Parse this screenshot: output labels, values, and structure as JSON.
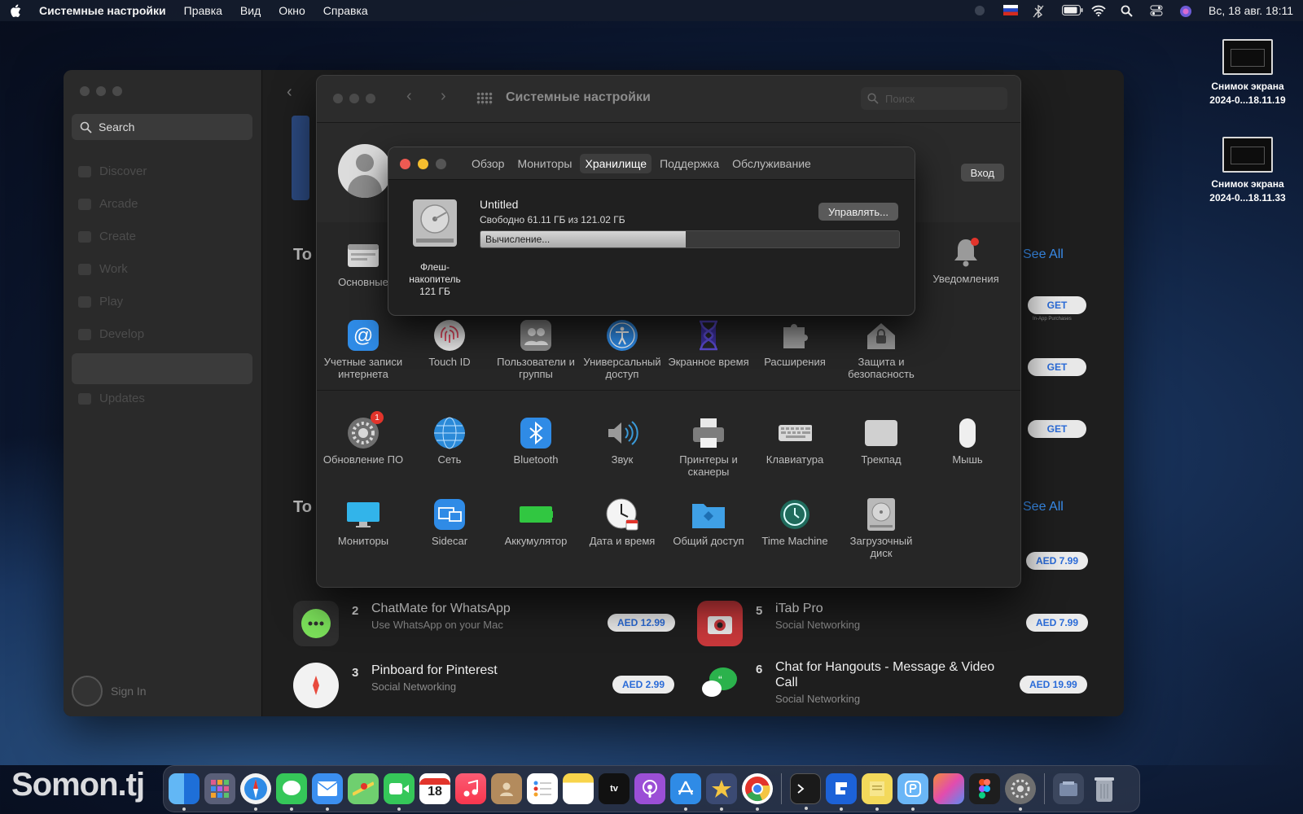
{
  "menubar": {
    "app_name": "Системные настройки",
    "items": [
      "Правка",
      "Вид",
      "Окно",
      "Справка"
    ],
    "datetime": "Вс, 18 авг.  18:11"
  },
  "desktop": {
    "files": [
      {
        "title": "Снимок экрана",
        "subtitle": "2024-0...18.11.19"
      },
      {
        "title": "Снимок экрана",
        "subtitle": "2024-0...18.11.33"
      }
    ]
  },
  "appstore": {
    "search_label": "Search",
    "nav": [
      "Discover",
      "Arcade",
      "Create",
      "Work",
      "Play",
      "Develop",
      "",
      "Updates"
    ],
    "sign_in": "Sign In",
    "section_head_1": "To",
    "section_head_2": "To",
    "see_all": "See All",
    "get_label": "GET",
    "iap_note": "In-App Purchases",
    "prices_top": [
      "AED 7.99"
    ],
    "apps": [
      {
        "rank": "2",
        "name": "ChatMate for WhatsApp",
        "sub": "Use WhatsApp on your Mac",
        "price": "AED 12.99"
      },
      {
        "rank": "3",
        "name": "Pinboard for Pinterest",
        "sub": "Social Networking",
        "price": "AED 2.99"
      },
      {
        "rank": "5",
        "name": "iTab Pro",
        "sub": "Social Networking",
        "price": "AED 7.99"
      },
      {
        "rank": "6",
        "name": "Chat for Hangouts - Message & Video Call",
        "sub": "Social Networking",
        "price": "AED 19.99"
      }
    ]
  },
  "syspref": {
    "title": "Системные настройки",
    "search_placeholder": "Поиск",
    "login_button": "Вход",
    "row0": [
      {
        "label": "Основные",
        "icon": "general-icon"
      },
      {
        "label": "Уведомления",
        "icon": "bell-icon"
      }
    ],
    "row1": [
      {
        "label": "Учетные записи интернета",
        "icon": "at-icon"
      },
      {
        "label": "Touch ID",
        "icon": "fingerprint-icon"
      },
      {
        "label": "Пользователи и группы",
        "icon": "users-icon"
      },
      {
        "label": "Универсальный доступ",
        "icon": "accessibility-icon"
      },
      {
        "label": "Экранное время",
        "icon": "hourglass-icon"
      },
      {
        "label": "Расширения",
        "icon": "puzzle-icon"
      },
      {
        "label": "Защита и безопасность",
        "icon": "house-lock-icon"
      }
    ],
    "row2": [
      {
        "label": "Обновление ПО",
        "icon": "gear-icon",
        "badge": "1"
      },
      {
        "label": "Сеть",
        "icon": "globe-icon"
      },
      {
        "label": "Bluetooth",
        "icon": "bluetooth-icon"
      },
      {
        "label": "Звук",
        "icon": "speaker-icon"
      },
      {
        "label": "Принтеры и сканеры",
        "icon": "printer-icon"
      },
      {
        "label": "Клавиатура",
        "icon": "keyboard-icon"
      },
      {
        "label": "Трекпад",
        "icon": "trackpad-icon"
      },
      {
        "label": "Мышь",
        "icon": "mouse-icon"
      }
    ],
    "row3": [
      {
        "label": "Мониторы",
        "icon": "monitor-icon"
      },
      {
        "label": "Sidecar",
        "icon": "sidecar-icon"
      },
      {
        "label": "Аккумулятор",
        "icon": "battery-icon"
      },
      {
        "label": "Дата и время",
        "icon": "clock-icon"
      },
      {
        "label": "Общий доступ",
        "icon": "folder-share-icon"
      },
      {
        "label": "Time Machine",
        "icon": "time-machine-icon"
      },
      {
        "label": "Загрузочный диск",
        "icon": "disk-icon"
      }
    ]
  },
  "about": {
    "tabs": [
      "Обзор",
      "Мониторы",
      "Хранилище",
      "Поддержка",
      "Обслуживание"
    ],
    "active_tab": "Хранилище",
    "volume_name": "Untitled",
    "volume_free": "Свободно 61.11 ГБ из 121.02 ГБ",
    "manage_button": "Управлять...",
    "progress_text": "Вычисление...",
    "progress_fraction": 0.49,
    "disk_label_1": "Флеш-",
    "disk_label_2": "накопитель",
    "disk_label_3": "121 ГБ"
  },
  "dock": {
    "watermark": "Somon.tj",
    "calendar_day": "18",
    "appletv_label": "tv",
    "items": [
      "finder-icon",
      "launchpad-icon",
      "safari-icon",
      "messages-icon",
      "mail-icon",
      "maps-icon",
      "facetime-icon",
      "calendar-icon",
      "music-icon",
      "contacts-icon",
      "reminders-icon",
      "notes-icon",
      "appletv-icon",
      "podcasts-icon",
      "appstore-icon",
      "reeder-icon",
      "chrome-icon",
      "terminal-icon",
      "app-f-icon",
      "stickies-icon",
      "app-b-icon",
      "pages-icon",
      "figma-icon",
      "syspref-icon",
      "downloads-icon",
      "trash-icon"
    ]
  },
  "colors": {
    "accent_blue": "#3a8ff0",
    "traffic_red": "#ee5a52",
    "traffic_yellow": "#f4bd2f",
    "traffic_gray": "#555555",
    "badge_red": "#e2342b"
  }
}
